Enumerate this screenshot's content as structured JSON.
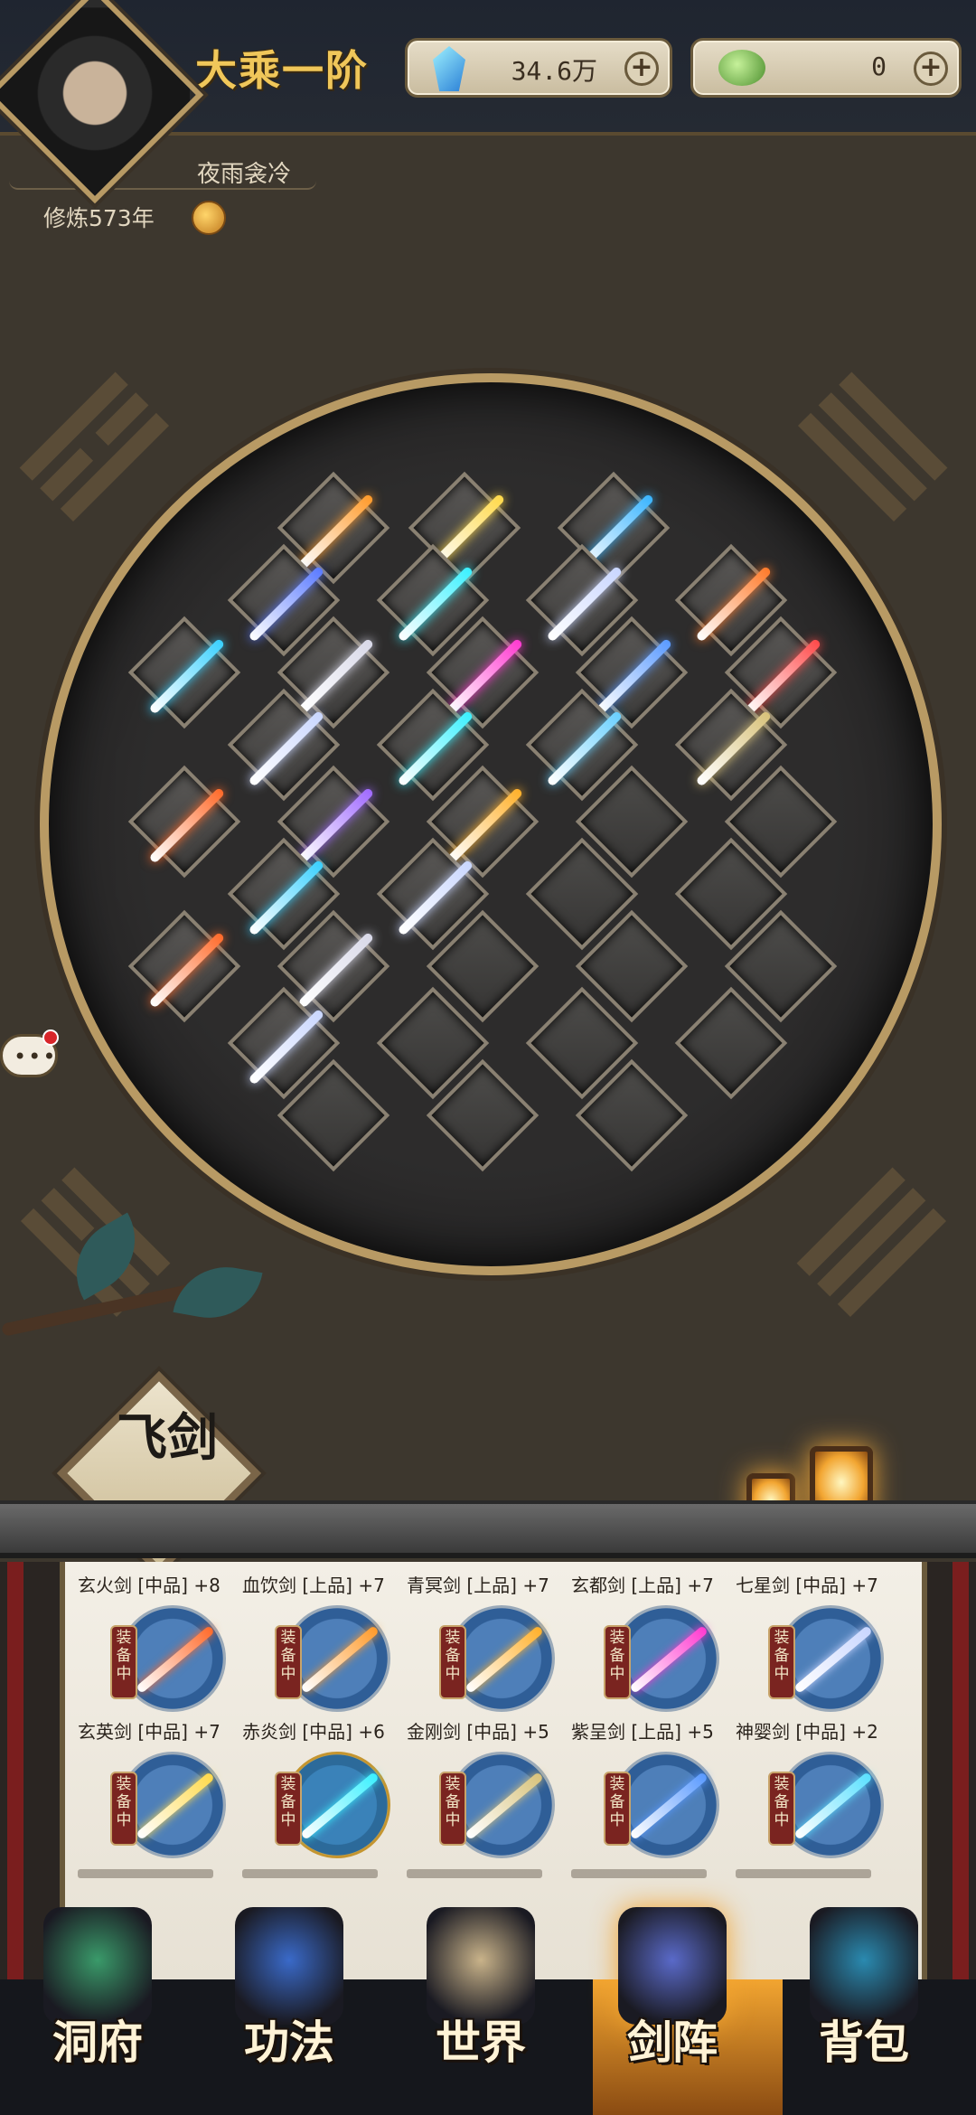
{
  "header": {
    "realm": "大乘一阶",
    "player_name": "夜雨衾冷",
    "cultivation": "修炼573年",
    "resources": [
      {
        "name": "spirit-crystal",
        "value": "34.6万"
      },
      {
        "name": "jade",
        "value": "0"
      }
    ]
  },
  "formation": {
    "panel_label": "飞剑"
  },
  "inventory": {
    "equipped_tag": "装备中",
    "row1": [
      {
        "name": "玄火剑 [中品] +8",
        "color": "#ff6a2a"
      },
      {
        "name": "血饮剑 [上品] +7",
        "color": "#ff9a2a"
      },
      {
        "name": "青冥剑 [上品] +7",
        "color": "#ffb02a"
      },
      {
        "name": "玄都剑 [上品] +7",
        "color": "#ff3ad0"
      },
      {
        "name": "七星剑 [中品] +7",
        "color": "#c9d6ff"
      }
    ],
    "row2": [
      {
        "name": "玄英剑 [中品] +7",
        "color": "#ffd94a"
      },
      {
        "name": "赤炎剑 [中品] +6",
        "color": "#3af0ff"
      },
      {
        "name": "金刚剑 [中品] +5",
        "color": "#d8c27a"
      },
      {
        "name": "紫呈剑 [上品] +5",
        "color": "#5a9aff"
      },
      {
        "name": "神婴剑 [中品] +2",
        "color": "#5ae0ff"
      }
    ]
  },
  "nav": [
    {
      "label": "洞府",
      "icon": "cave-dwelling-icon"
    },
    {
      "label": "功法",
      "icon": "technique-book-icon"
    },
    {
      "label": "世界",
      "icon": "world-scroll-icon"
    },
    {
      "label": "剑阵",
      "icon": "sword-formation-icon",
      "active": true
    },
    {
      "label": "背包",
      "icon": "backpack-icon"
    }
  ],
  "colors": {
    "accent_gold": "#f0c75a",
    "frame_gold": "#b89a64",
    "active_tab": "#f2a531"
  }
}
